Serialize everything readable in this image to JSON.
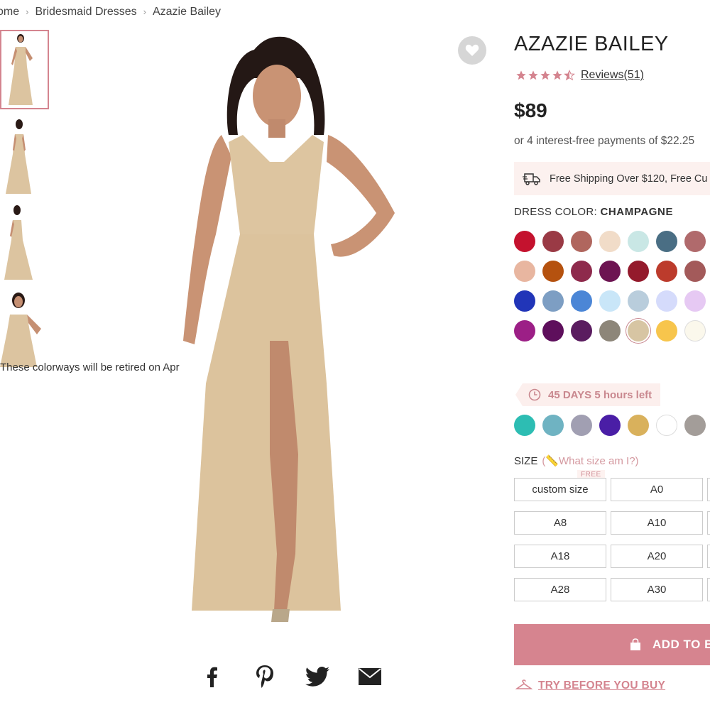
{
  "breadcrumb": {
    "home": "ome",
    "category": "Bridesmaid Dresses",
    "current": "Azazie Bailey"
  },
  "product": {
    "title": "AZAZIE BAILEY",
    "rating": 4.5,
    "reviews_label": "Reviews(51)",
    "price": "$89",
    "payments": "or 4 interest-free payments of $22.25",
    "shipping": "Free Shipping Over $120, Free Cu"
  },
  "colors": {
    "label": "DRESS COLOR:",
    "selected": "CHAMPAGNE",
    "swatches": [
      "#c4122e",
      "#9a3a45",
      "#b0665e",
      "#f1dcc8",
      "#c9e7e5",
      "#4a6e84",
      "#b06a6c",
      "#e8b6a0",
      "#b5520f",
      "#8e2a4c",
      "#6d1452",
      "#941a2c",
      "#bc3b2c",
      "#a35a5a",
      "#2135b8",
      "#7d9ec3",
      "#4b86d6",
      "#c9e6f8",
      "#b9cddc",
      "#d5dbfb",
      "#e6c9f3",
      "#9c1f86",
      "#5e0f5c",
      "#5a1c5f",
      "#8d8679",
      "#d7c5a3",
      "#f7c54c",
      "#fbf8ec"
    ],
    "selected_index": 25,
    "retire_text": "These colorways will be retired on Apr",
    "countdown": "45 DAYS 5 hours left",
    "retiring_swatches": [
      "#2dbdb3",
      "#6fb3c2",
      "#a19fb2",
      "#4a1ea6",
      "#d9b15c",
      "#ffffff",
      "#a39d99"
    ]
  },
  "size": {
    "label": "SIZE",
    "help": "(📏What size am I?)",
    "free_badge": "FREE",
    "options": [
      [
        "custom size",
        "A0"
      ],
      [
        "A8",
        "A10"
      ],
      [
        "A18",
        "A20"
      ],
      [
        "A28",
        "A30"
      ]
    ]
  },
  "actions": {
    "add_to_bag": "ADD TO B",
    "try_before": "TRY BEFORE YOU BUY"
  },
  "colors_ui": {
    "accent": "#d6848f",
    "accent_light": "#fcefed"
  }
}
